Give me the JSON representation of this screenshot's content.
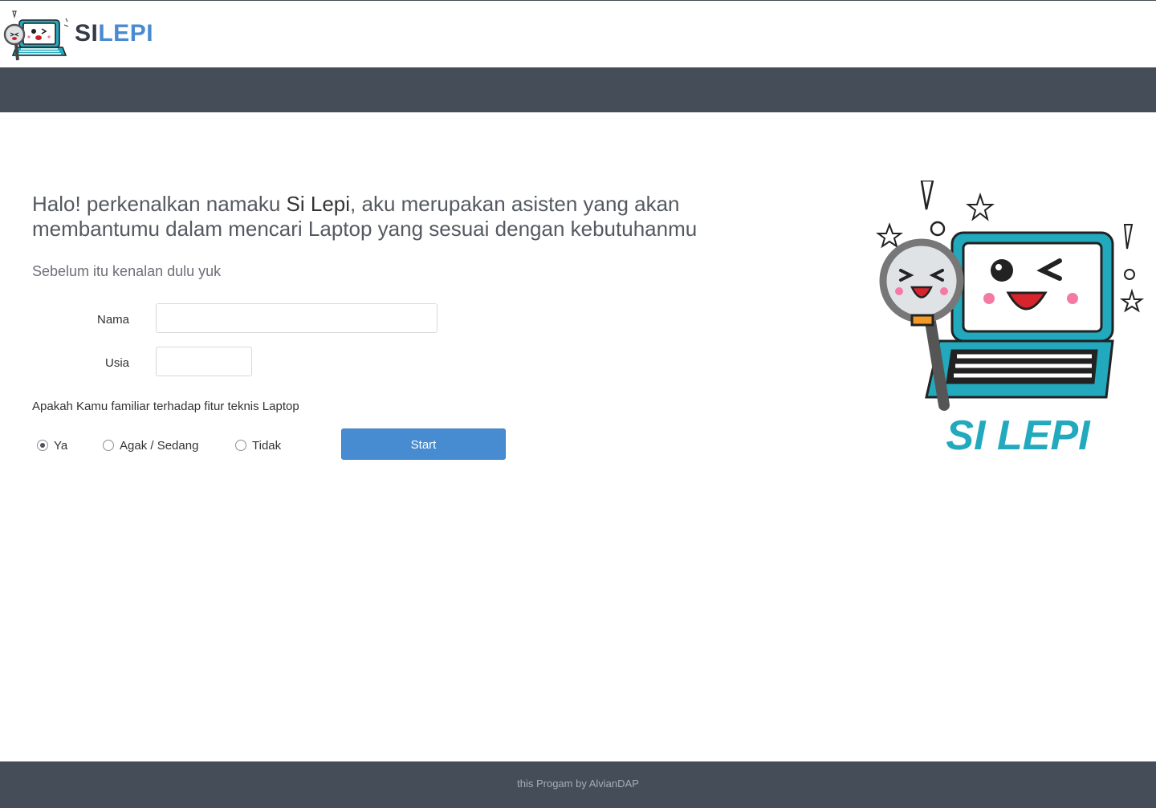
{
  "header": {
    "brand_part1": "SI",
    "brand_part2": "LEPI",
    "logo_icon": "laptop-mascot-icon"
  },
  "main": {
    "intro_pre": "Halo! perkenalkan namaku ",
    "intro_name": "Si Lepi",
    "intro_post": ", aku merupakan asisten yang akan membantumu dalam mencari Laptop yang sesuai dengan kebutuhanmu",
    "subtitle": "Sebelum itu kenalan dulu yuk",
    "form": {
      "nama_label": "Nama",
      "nama_value": "",
      "usia_label": "Usia",
      "usia_value": "",
      "question": "Apakah Kamu familiar terhadap fitur teknis Laptop",
      "options": [
        {
          "label": "Ya",
          "checked": true
        },
        {
          "label": "Agak / Sedang",
          "checked": false
        },
        {
          "label": "Tidak",
          "checked": false
        }
      ],
      "start_label": "Start"
    },
    "mascot_title": "SI LEPI"
  },
  "footer": {
    "text": "this Progam by AlvianDAP"
  },
  "colors": {
    "brand_dark": "#353b45",
    "brand_blue": "#4a8ad1",
    "navbar": "#454d59",
    "button": "#478bd0",
    "mascot_teal": "#22a9bd"
  }
}
